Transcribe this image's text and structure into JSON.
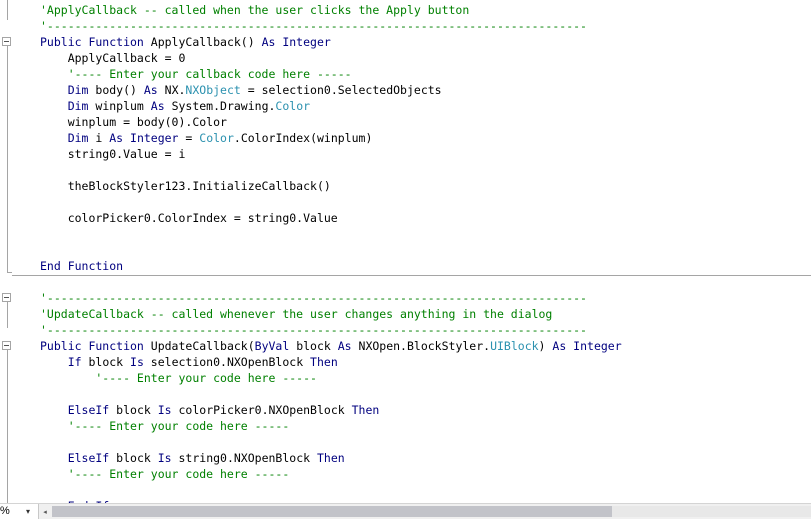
{
  "editor": {
    "lines": [
      [
        [
          "cm",
          "'ApplyCallback -- called when the user clicks the Apply button"
        ]
      ],
      [
        [
          "cm",
          "'------------------------------------------------------------------------------"
        ]
      ],
      [
        [
          "kw",
          "Public Function "
        ],
        [
          "t",
          "ApplyCallback() "
        ],
        [
          "kw",
          "As Integer"
        ]
      ],
      [
        [
          "t",
          "    ApplyCallback = 0"
        ]
      ],
      [
        [
          "cm",
          "    '---- Enter your callback code here -----"
        ]
      ],
      [
        [
          "kw",
          "    Dim "
        ],
        [
          "t",
          "body() "
        ],
        [
          "kw",
          "As "
        ],
        [
          "t",
          "NX."
        ],
        [
          "ty",
          "NXObject"
        ],
        [
          "t",
          " = selection0.SelectedObjects"
        ]
      ],
      [
        [
          "kw",
          "    Dim "
        ],
        [
          "t",
          "winplum "
        ],
        [
          "kw",
          "As "
        ],
        [
          "t",
          "System.Drawing."
        ],
        [
          "ty",
          "Color"
        ]
      ],
      [
        [
          "t",
          "    winplum = body(0).Color"
        ]
      ],
      [
        [
          "kw",
          "    Dim "
        ],
        [
          "t",
          "i "
        ],
        [
          "kw",
          "As Integer"
        ],
        [
          "t",
          " = "
        ],
        [
          "ty",
          "Color"
        ],
        [
          "t",
          ".ColorIndex(winplum)"
        ]
      ],
      [
        [
          "t",
          "    string0.Value = i"
        ]
      ],
      [],
      [
        [
          "t",
          "    theBlockStyler123.InitializeCallback()"
        ]
      ],
      [],
      [
        [
          "t",
          "    colorPicker0.ColorIndex = string0.Value"
        ]
      ],
      [],
      [],
      [
        [
          "kw",
          "End Function"
        ]
      ],
      [],
      [
        [
          "cm",
          "'------------------------------------------------------------------------------"
        ]
      ],
      [
        [
          "cm",
          "'UpdateCallback -- called whenever the user changes anything in the dialog"
        ]
      ],
      [
        [
          "cm",
          "'------------------------------------------------------------------------------"
        ]
      ],
      [
        [
          "kw",
          "Public Function "
        ],
        [
          "t",
          "UpdateCallback("
        ],
        [
          "kw",
          "ByVal "
        ],
        [
          "t",
          "block "
        ],
        [
          "kw",
          "As "
        ],
        [
          "t",
          "NXOpen.BlockStyler."
        ],
        [
          "ty",
          "UIBlock"
        ],
        [
          "t",
          ") "
        ],
        [
          "kw",
          "As Integer"
        ]
      ],
      [
        [
          "kw",
          "    If "
        ],
        [
          "t",
          "block "
        ],
        [
          "kw",
          "Is "
        ],
        [
          "t",
          "selection0.NXOpenBlock "
        ],
        [
          "kw",
          "Then"
        ]
      ],
      [
        [
          "cm",
          "        '---- Enter your code here -----"
        ]
      ],
      [],
      [
        [
          "kw",
          "    ElseIf "
        ],
        [
          "t",
          "block "
        ],
        [
          "kw",
          "Is "
        ],
        [
          "t",
          "colorPicker0.NXOpenBlock "
        ],
        [
          "kw",
          "Then"
        ]
      ],
      [
        [
          "cm",
          "    '---- Enter your code here -----"
        ]
      ],
      [],
      [
        [
          "kw",
          "    ElseIf "
        ],
        [
          "t",
          "block "
        ],
        [
          "kw",
          "Is "
        ],
        [
          "t",
          "string0.NXOpenBlock "
        ],
        [
          "kw",
          "Then"
        ]
      ],
      [
        [
          "cm",
          "    '---- Enter your code here -----"
        ]
      ],
      [],
      [
        [
          "kw",
          "    End If"
        ]
      ]
    ]
  },
  "statusbar": {
    "zoom_label": "%",
    "zoom_arrow": "▾",
    "scroll_left_arrow": "◂"
  },
  "colors": {
    "keyword": "#00007f",
    "type": "#2b91af",
    "comment": "#008000"
  }
}
